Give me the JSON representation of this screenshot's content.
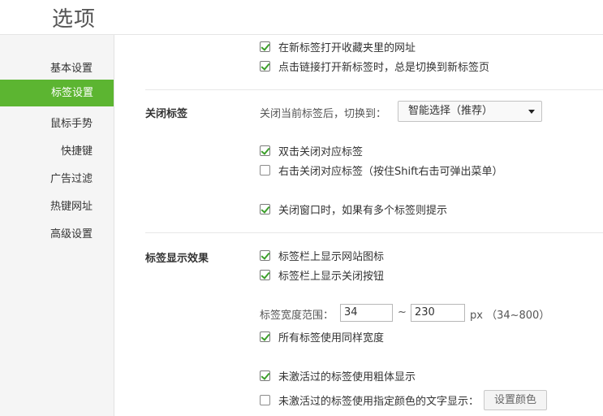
{
  "page": {
    "title": "选项"
  },
  "sidebar": {
    "items": [
      {
        "label": "基本设置"
      },
      {
        "label": "标签设置",
        "active": true
      },
      {
        "label": "鼠标手势"
      },
      {
        "label": "快捷键"
      },
      {
        "label": "广告过滤"
      },
      {
        "label": "热键网址"
      },
      {
        "label": "高级设置"
      }
    ]
  },
  "open_tabs": {
    "checkboxes": [
      {
        "label": "在新标签打开收藏夹里的网址",
        "checked": true
      },
      {
        "label": "点击链接打开新标签时，总是切换到新标签页",
        "checked": true
      }
    ]
  },
  "close_tab": {
    "section_label": "关闭标签",
    "switch_label": "关闭当前标签后，切换到：",
    "switch_value": "智能选择（推荐）",
    "checkboxes": [
      {
        "label": "双击关闭对应标签",
        "checked": true
      },
      {
        "label": "右击关闭对应标签（按住Shift右击可弹出菜单）",
        "checked": false
      },
      {
        "label": "关闭窗口时，如果有多个标签则提示",
        "checked": true
      }
    ]
  },
  "tab_display": {
    "section_label": "标签显示效果",
    "checkboxes": [
      {
        "label": "标签栏上显示网站图标",
        "checked": true
      },
      {
        "label": "标签栏上显示关闭按钮",
        "checked": true
      }
    ],
    "width_range": {
      "label": "标签宽度范围：",
      "min": "34",
      "separator": "~",
      "max": "230",
      "unit_hint": "px （34~800）"
    },
    "same_width": {
      "label": "所有标签使用同样宽度",
      "checked": true
    },
    "bold_inactive": {
      "label": "未激活过的标签使用粗体显示",
      "checked": true
    },
    "color_inactive": {
      "label": "未激活过的标签使用指定颜色的文字显示：",
      "checked": false
    },
    "set_color_button": "设置颜色"
  },
  "colors": {
    "accent": "#5cb531",
    "check": "#3c9f2b"
  }
}
